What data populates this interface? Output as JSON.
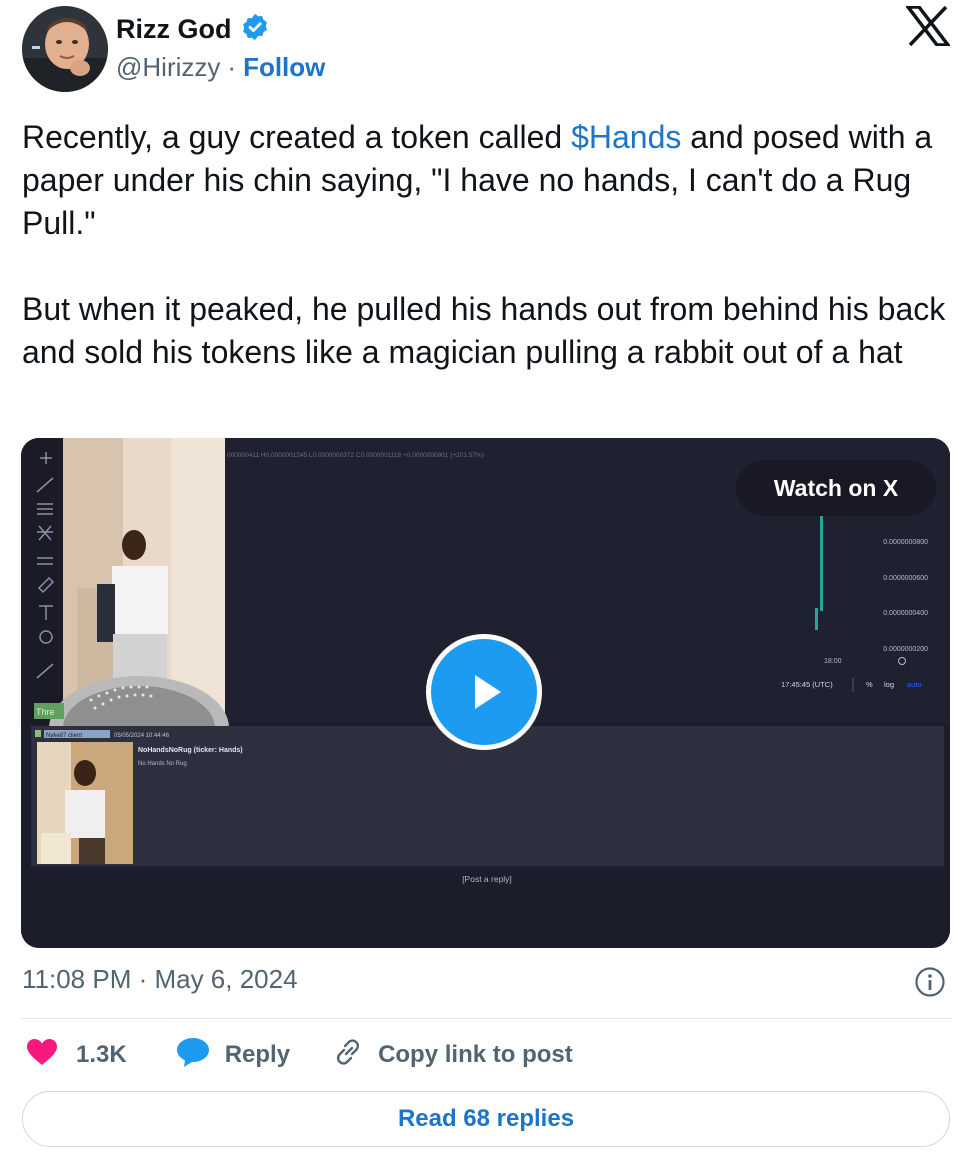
{
  "author": {
    "name": "Rizz God",
    "handle": "@Hirizzy",
    "separator": "·",
    "follow_label": "Follow"
  },
  "tweet": {
    "text_before": "Recently, a guy created a token called ",
    "cashtag": "$Hands",
    "text_after": " and posed with a paper under his chin saying, \"I have no hands, I can't do a Rug Pull.\"\n\nBut when it peaked, he pulled his hands out from behind his back and sold his tokens like a magician pulling a rabbit out of a hat"
  },
  "media": {
    "watch_label": "Watch on X",
    "ohlc": "000000411 H0.0000001245 L0.0000000372 C0.0000001118 +0.0000000801 (+201.57%)",
    "price_ticks": [
      "0.0000000800",
      "0.0000000600",
      "0.0000000400",
      "0.0000000200"
    ],
    "time_tick": "18:00",
    "time_utc": "17:45:45 (UTC)",
    "scale_percent": "%",
    "scale_log": "log",
    "scale_auto": "auto",
    "thread_tag": "Thre",
    "post_user": "Nyke87 client",
    "post_date": "05/05/2024 10:44:46",
    "post_title": "NoHandsNoRug (ticker: Hands)",
    "post_sub": "No Hands No Rug",
    "post_reply": "[Post a reply]"
  },
  "timestamp": "11:08 PM · May 6, 2024",
  "actions": {
    "likes": "1.3K",
    "reply_label": "Reply",
    "copy_label": "Copy link to post"
  },
  "read_replies_label": "Read 68 replies",
  "colors": {
    "link_blue": "#1d74c9",
    "verified_blue": "#1d9bf0",
    "like_pink": "#f91880",
    "muted_gray": "#536471",
    "video_bg": "#1c1d2a"
  }
}
